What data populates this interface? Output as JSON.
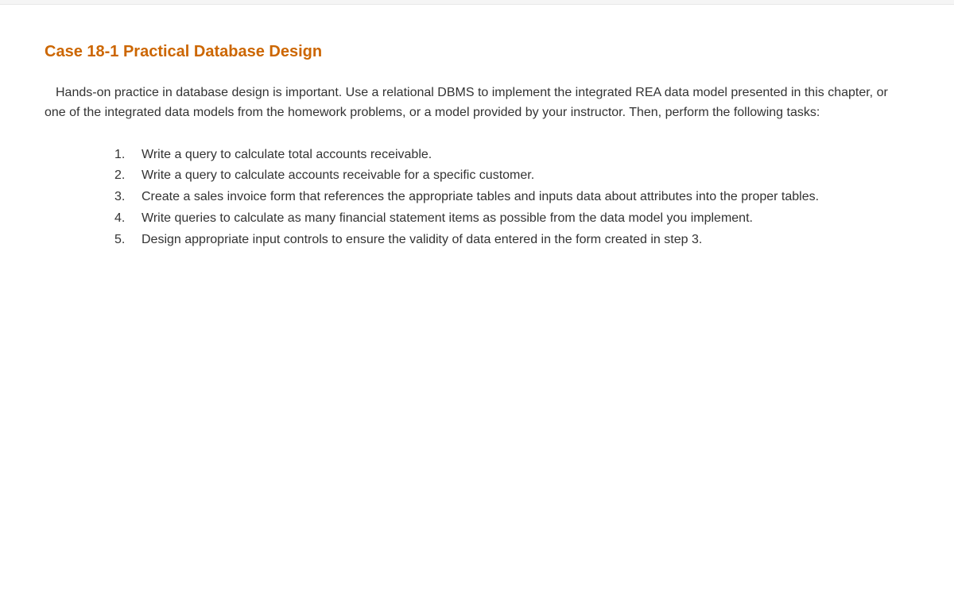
{
  "heading": "Case 18-1 Practical Database Design",
  "intro": "Hands-on practice in database design is important. Use a relational DBMS to implement the integrated REA data model presented in this chapter, or one of the integrated data models from the homework problems, or a model provided by your instructor. Then, perform the following tasks:",
  "items": [
    {
      "num": "1.",
      "text": "Write a query to calculate total accounts receivable."
    },
    {
      "num": "2.",
      "text": "Write a query to calculate accounts receivable for a specific customer."
    },
    {
      "num": "3.",
      "text": "Create a sales invoice form that references the appropriate tables and inputs data about attributes into the proper tables."
    },
    {
      "num": "4.",
      "text": "Write queries to calculate as many financial statement items as possible from the data model you implement."
    },
    {
      "num": "5.",
      "text": "Design appropriate input controls to ensure the validity of data entered in the form created in step 3."
    }
  ]
}
